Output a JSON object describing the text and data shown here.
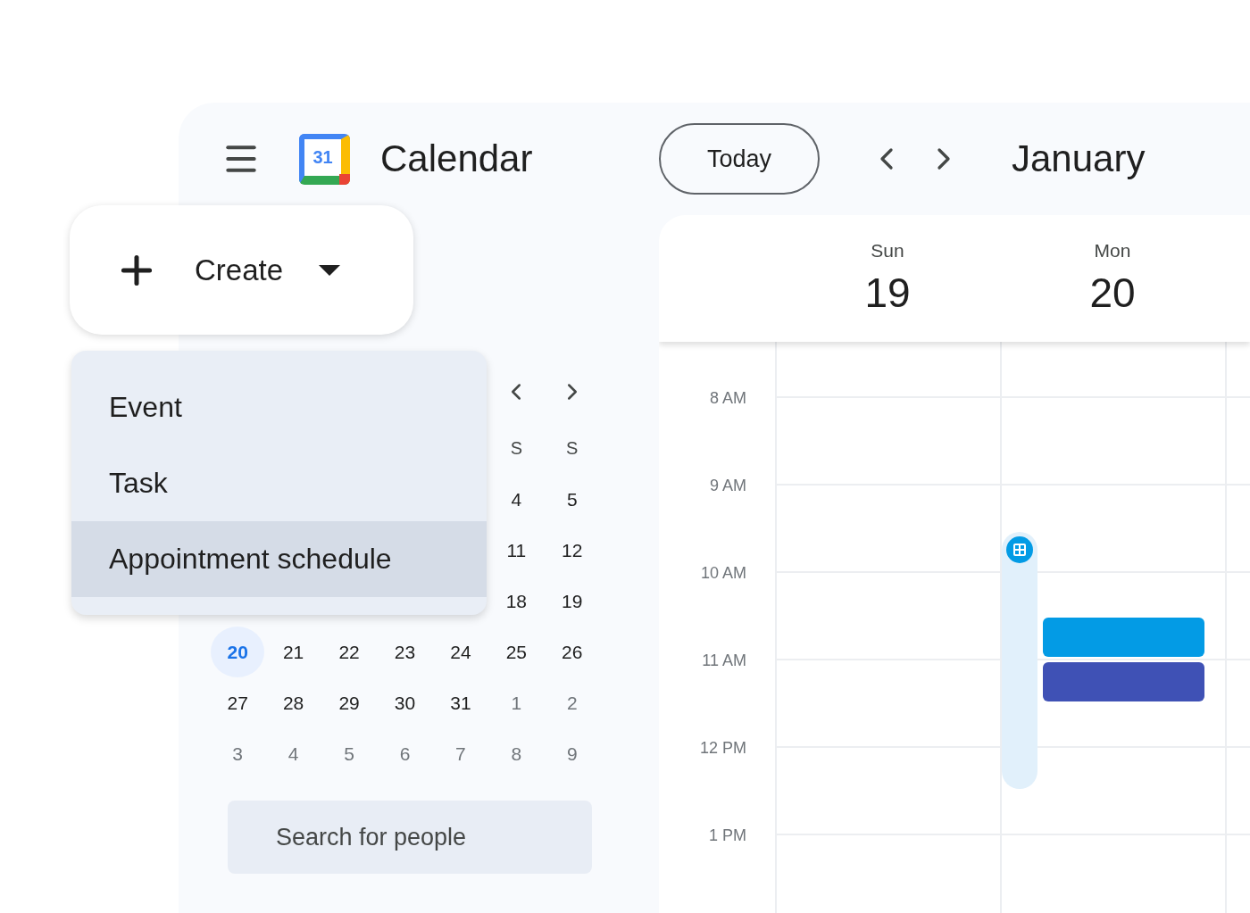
{
  "header": {
    "app_name": "Calendar",
    "logo_text": "31",
    "today_button": "Today",
    "month": "January"
  },
  "create_button": {
    "label": "Create"
  },
  "create_menu": [
    {
      "label": "Event",
      "selected": false
    },
    {
      "label": "Task",
      "selected": false
    },
    {
      "label": "Appointment schedule",
      "selected": true
    }
  ],
  "mini_calendar": {
    "weekdays": [
      "S",
      "S"
    ],
    "rows": [
      {
        "days": [
          {
            "text": "4",
            "selected": false,
            "dimmed": false
          },
          {
            "text": "5",
            "selected": false,
            "dimmed": false
          }
        ]
      },
      {
        "days": [
          {
            "text": "11",
            "selected": false,
            "dimmed": false
          },
          {
            "text": "12",
            "selected": false,
            "dimmed": false
          }
        ]
      },
      {
        "days": [
          {
            "text": "18",
            "selected": false,
            "dimmed": false
          },
          {
            "text": "19",
            "selected": false,
            "dimmed": false
          }
        ]
      },
      {
        "days": [
          {
            "text": "20",
            "selected": true,
            "dimmed": false
          },
          {
            "text": "21",
            "selected": false,
            "dimmed": false
          },
          {
            "text": "22",
            "selected": false,
            "dimmed": false
          },
          {
            "text": "23",
            "selected": false,
            "dimmed": false
          },
          {
            "text": "24",
            "selected": false,
            "dimmed": false
          },
          {
            "text": "25",
            "selected": false,
            "dimmed": false
          },
          {
            "text": "26",
            "selected": false,
            "dimmed": false
          }
        ]
      },
      {
        "days": [
          {
            "text": "27",
            "selected": false,
            "dimmed": false
          },
          {
            "text": "28",
            "selected": false,
            "dimmed": false
          },
          {
            "text": "29",
            "selected": false,
            "dimmed": false
          },
          {
            "text": "30",
            "selected": false,
            "dimmed": false
          },
          {
            "text": "31",
            "selected": false,
            "dimmed": false
          },
          {
            "text": "1",
            "selected": false,
            "dimmed": true
          },
          {
            "text": "2",
            "selected": false,
            "dimmed": true
          }
        ]
      },
      {
        "days": [
          {
            "text": "3",
            "selected": false,
            "dimmed": true
          },
          {
            "text": "4",
            "selected": false,
            "dimmed": true
          },
          {
            "text": "5",
            "selected": false,
            "dimmed": true
          },
          {
            "text": "6",
            "selected": false,
            "dimmed": true
          },
          {
            "text": "7",
            "selected": false,
            "dimmed": true
          },
          {
            "text": "8",
            "selected": false,
            "dimmed": true
          },
          {
            "text": "9",
            "selected": false,
            "dimmed": true
          }
        ]
      }
    ]
  },
  "search": {
    "placeholder": "Search for people"
  },
  "week_view": {
    "days": [
      {
        "weekday": "Sun",
        "date": "19"
      },
      {
        "weekday": "Mon",
        "date": "20"
      }
    ],
    "hours": [
      "8 AM",
      "9 AM",
      "10 AM",
      "11 AM",
      "12 PM",
      "1 PM"
    ],
    "events": [
      {
        "color": "#039be5"
      },
      {
        "color": "#3f51b5"
      }
    ]
  }
}
